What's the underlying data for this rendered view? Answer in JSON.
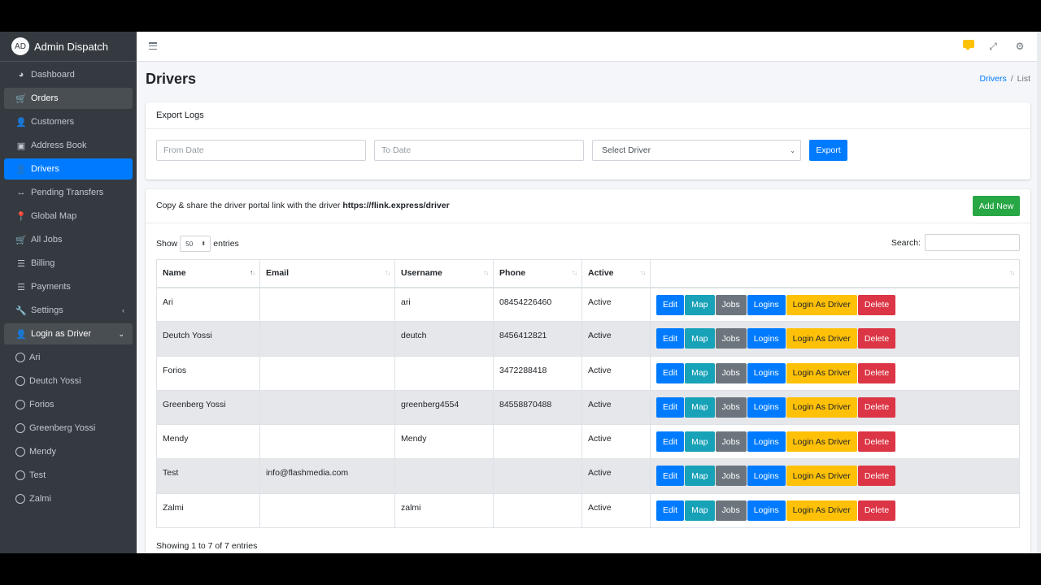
{
  "brand": {
    "logo": "AD",
    "name": "Admin Dispatch"
  },
  "sidebar": {
    "items": [
      {
        "label": "Dashboard",
        "icon": "dashboard-icon",
        "glyph": "◕"
      },
      {
        "label": "Orders",
        "icon": "cart-icon",
        "glyph": "🛒"
      },
      {
        "label": "Customers",
        "icon": "user-icon",
        "glyph": "👤"
      },
      {
        "label": "Address Book",
        "icon": "address-book-icon",
        "glyph": "▣"
      },
      {
        "label": "Drivers",
        "icon": "user-icon",
        "glyph": "👤"
      },
      {
        "label": "Pending Transfers",
        "icon": "arrows-h-icon",
        "glyph": "↔"
      },
      {
        "label": "Global Map",
        "icon": "map-marker-icon",
        "glyph": "📍"
      },
      {
        "label": "All Jobs",
        "icon": "cart-icon",
        "glyph": "🛒"
      },
      {
        "label": "Billing",
        "icon": "list-icon",
        "glyph": "☰"
      },
      {
        "label": "Payments",
        "icon": "list-icon",
        "glyph": "☰"
      },
      {
        "label": "Settings",
        "icon": "wrench-icon",
        "glyph": "🔧",
        "caret": "‹"
      },
      {
        "label": "Login as Driver",
        "icon": "user-icon",
        "glyph": "👤",
        "caret": "⌄"
      }
    ],
    "drivers": [
      "Ari",
      "Deutch Yossi",
      "Forios",
      "Greenberg Yossi",
      "Mendy",
      "Test",
      "Zalmi"
    ]
  },
  "topbar": {
    "icons": [
      "messages-icon",
      "fullscreen-icon",
      "settings-cog-icon"
    ]
  },
  "page": {
    "title": "Drivers"
  },
  "breadcrumb": {
    "parent": "Drivers",
    "sep": "/",
    "current": "List"
  },
  "export": {
    "header": "Export Logs",
    "from_placeholder": "From Date",
    "to_placeholder": "To Date",
    "driver_select": "Select Driver",
    "export_label": "Export"
  },
  "list": {
    "share_prefix": "Copy & share the driver portal link with the driver",
    "share_link": "https://flink.express/driver",
    "add_new_label": "Add New",
    "show_label": "Show",
    "page_length": "50",
    "entries_label": "entries",
    "search_label": "Search:",
    "columns": [
      "Name",
      "Email",
      "Username",
      "Phone",
      "Active",
      ""
    ],
    "actions": [
      "Edit",
      "Map",
      "Jobs",
      "Logins",
      "Login As Driver",
      "Delete"
    ],
    "rows": [
      {
        "name": "Ari",
        "email": "",
        "username": "ari",
        "phone": "08454226460",
        "active": "Active"
      },
      {
        "name": "Deutch Yossi",
        "email": "",
        "username": "deutch",
        "phone": "8456412821",
        "active": "Active"
      },
      {
        "name": "Forios",
        "email": "",
        "username": "",
        "phone": "3472288418",
        "active": "Active"
      },
      {
        "name": "Greenberg Yossi",
        "email": "",
        "username": "greenberg4554",
        "phone": "84558870488",
        "active": "Active"
      },
      {
        "name": "Mendy",
        "email": "",
        "username": "Mendy",
        "phone": "",
        "active": "Active"
      },
      {
        "name": "Test",
        "email": "info@flashmedia.com",
        "username": "",
        "phone": "",
        "active": "Active"
      },
      {
        "name": "Zalmi",
        "email": "",
        "username": "zalmi",
        "phone": "",
        "active": "Active"
      }
    ],
    "info": "Showing 1 to 7 of 7 entries"
  },
  "colors": {
    "sidebar_bg": "#343a40",
    "active": "#007bff",
    "success": "#28a745",
    "info": "#17a2b8",
    "secondary": "#6c757d",
    "warning": "#ffc107",
    "danger": "#dc3545"
  }
}
